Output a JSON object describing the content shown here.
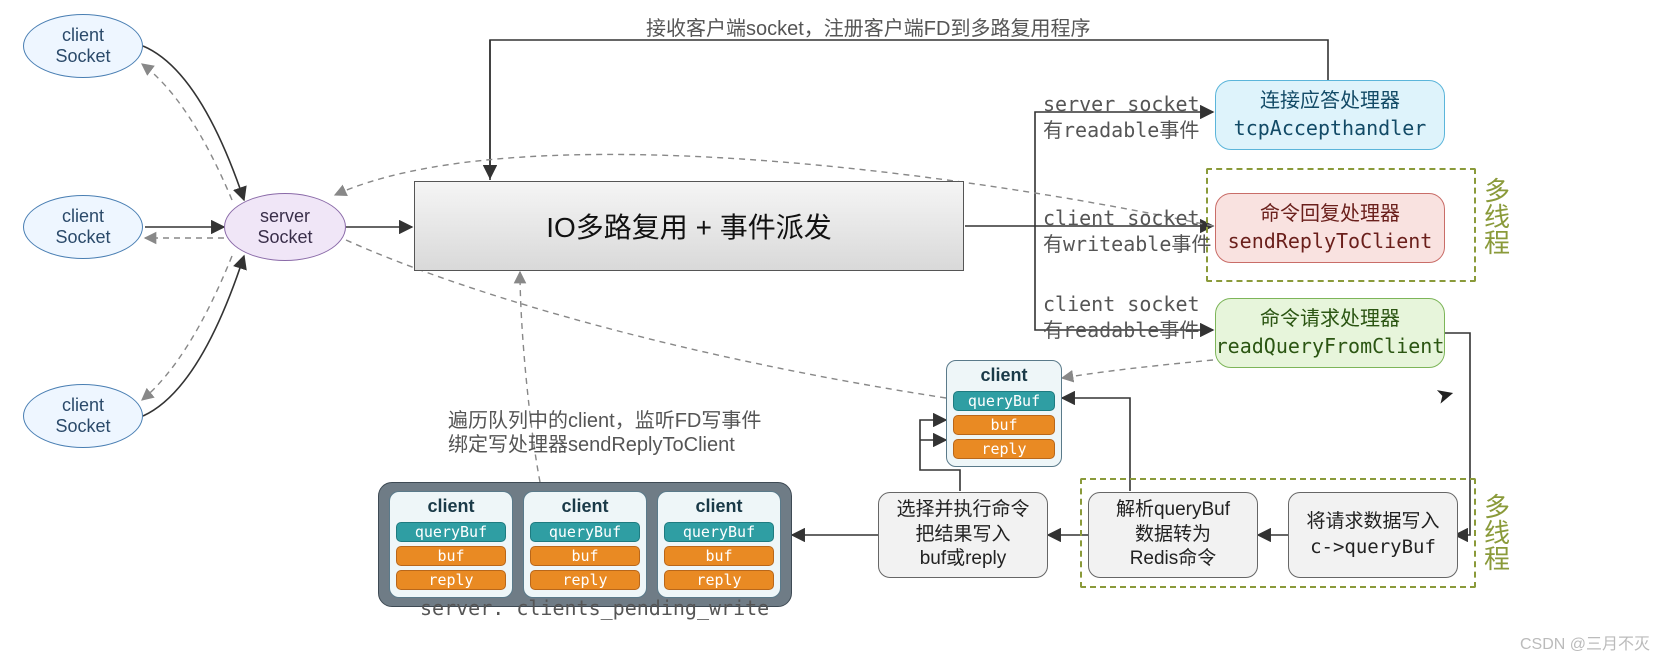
{
  "labels": {
    "clientSocket": "client\nSocket",
    "serverSocket": "server\nSocket",
    "ioBox": "IO多路复用 + 事件派发",
    "topNote": "接收客户端socket，注册客户端FD到多路复用程序",
    "serverReadable1": "server socket",
    "serverReadable2": "有readable事件",
    "clientWriteable1": "client socket",
    "clientWriteable2": "有writeable事件",
    "clientReadable1": "client socket",
    "clientReadable2": "有readable事件",
    "loopNote1": "遍历队列中的client，监听FD写事件",
    "loopNote2": "绑定写处理器sendReplyToClient",
    "multiThread": "多线程"
  },
  "handlers": {
    "accept1": "连接应答处理器",
    "accept2": "tcpAccepthandler",
    "reply1": "命令回复处理器",
    "reply2": "sendReplyToClient",
    "read1": "命令请求处理器",
    "read2": "readQueryFromClient"
  },
  "steps": {
    "writeReq1": "将请求数据写入",
    "writeReq2": "c->queryBuf",
    "parse1": "解析queryBuf",
    "parse2": "数据转为",
    "parse3": "Redis命令",
    "exec1": "选择并执行命令",
    "exec2": "把结果写入",
    "exec3": "buf或reply"
  },
  "client": {
    "title": "client",
    "queryBuf": "queryBuf",
    "buf": "buf",
    "reply": "reply"
  },
  "trayCaption": "server. clients_pending_write",
  "watermark": "CSDN @三月不灭"
}
